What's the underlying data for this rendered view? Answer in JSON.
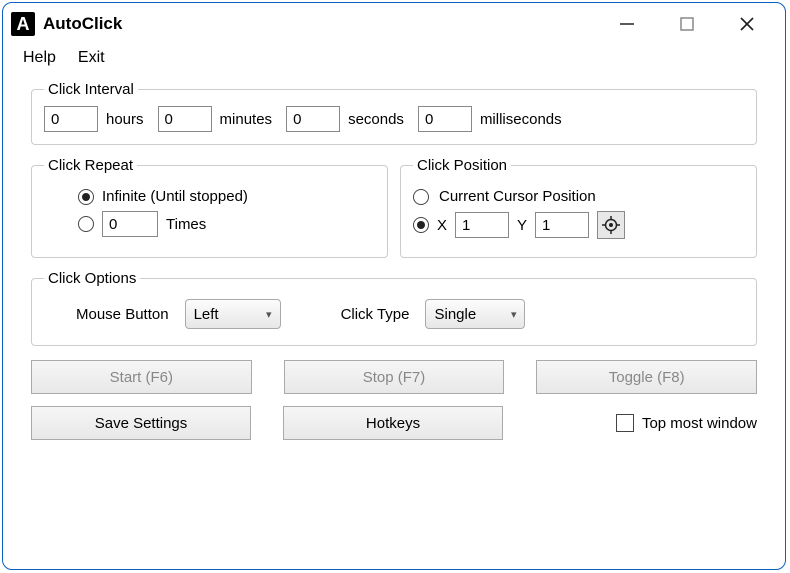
{
  "app": {
    "title": "AutoClick",
    "icon_letter": "A"
  },
  "menu": {
    "help": "Help",
    "exit": "Exit"
  },
  "interval": {
    "legend": "Click Interval",
    "hours": "0",
    "hours_label": "hours",
    "minutes": "0",
    "minutes_label": "minutes",
    "seconds": "0",
    "seconds_label": "seconds",
    "milliseconds": "0",
    "milliseconds_label": "milliseconds"
  },
  "repeat": {
    "legend": "Click Repeat",
    "infinite_label": "Infinite (Until stopped)",
    "times_value": "0",
    "times_label": "Times"
  },
  "position": {
    "legend": "Click Position",
    "cursor_label": "Current Cursor Position",
    "x_label": "X",
    "x_value": "1",
    "y_label": "Y",
    "y_value": "1"
  },
  "options": {
    "legend": "Click Options",
    "mouse_button_label": "Mouse Button",
    "mouse_button_value": "Left",
    "click_type_label": "Click Type",
    "click_type_value": "Single"
  },
  "actions": {
    "start": "Start (F6)",
    "stop": "Stop (F7)",
    "toggle": "Toggle (F8)",
    "save": "Save Settings",
    "hotkeys": "Hotkeys",
    "topmost": "Top most window"
  }
}
